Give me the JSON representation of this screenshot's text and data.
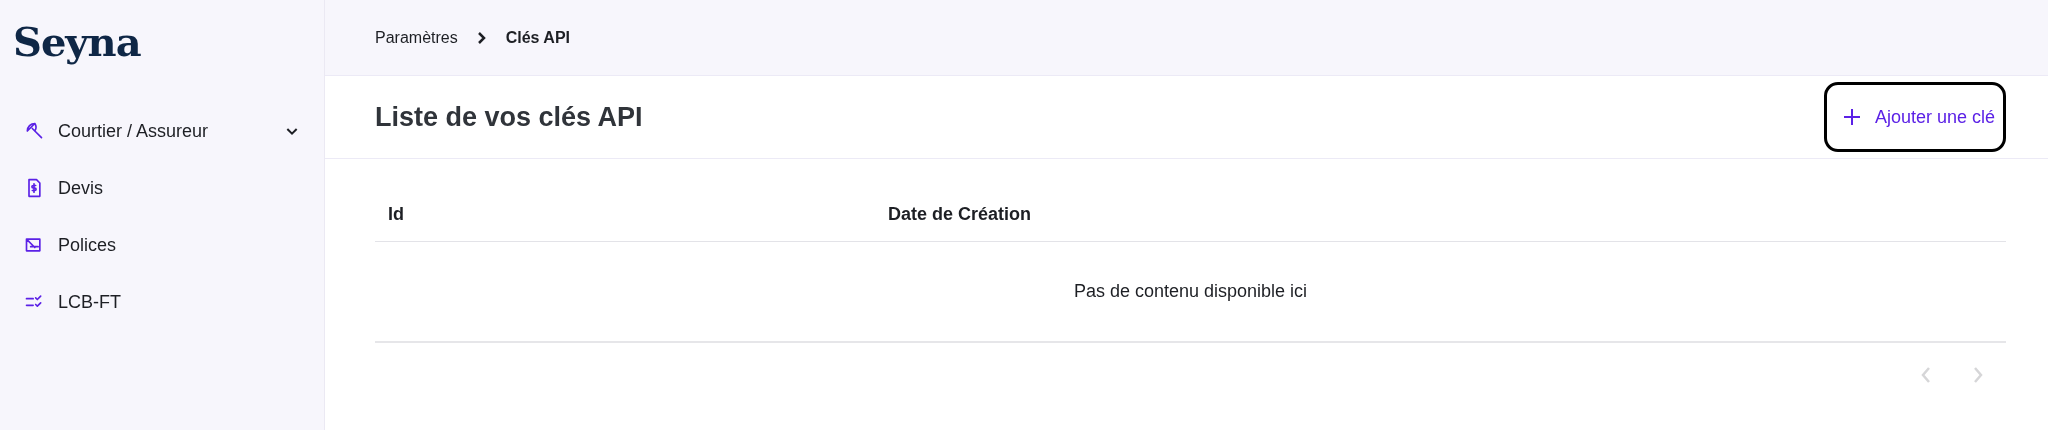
{
  "sidebar": {
    "logo": "Seyna",
    "items": [
      {
        "kind": "umbrella",
        "label": "Courtier / Assureur",
        "expanded": false
      },
      {
        "kind": "quote",
        "label": "Devis"
      },
      {
        "kind": "policy",
        "label": "Polices"
      },
      {
        "kind": "checklist",
        "label": "LCB-FT"
      }
    ]
  },
  "breadcrumb": [
    {
      "label": "Paramètres",
      "current": false
    },
    {
      "label": "Clés API",
      "current": true
    }
  ],
  "page_title": "Liste de vos clés API",
  "add_button": {
    "label": "Ajouter une clé",
    "focused": true
  },
  "table": {
    "columns": [
      "Id",
      "Date de Création"
    ],
    "empty_message": "Pas de contenu disponible ici"
  },
  "pagination": {
    "prev_disabled": true,
    "next_disabled": true
  }
}
